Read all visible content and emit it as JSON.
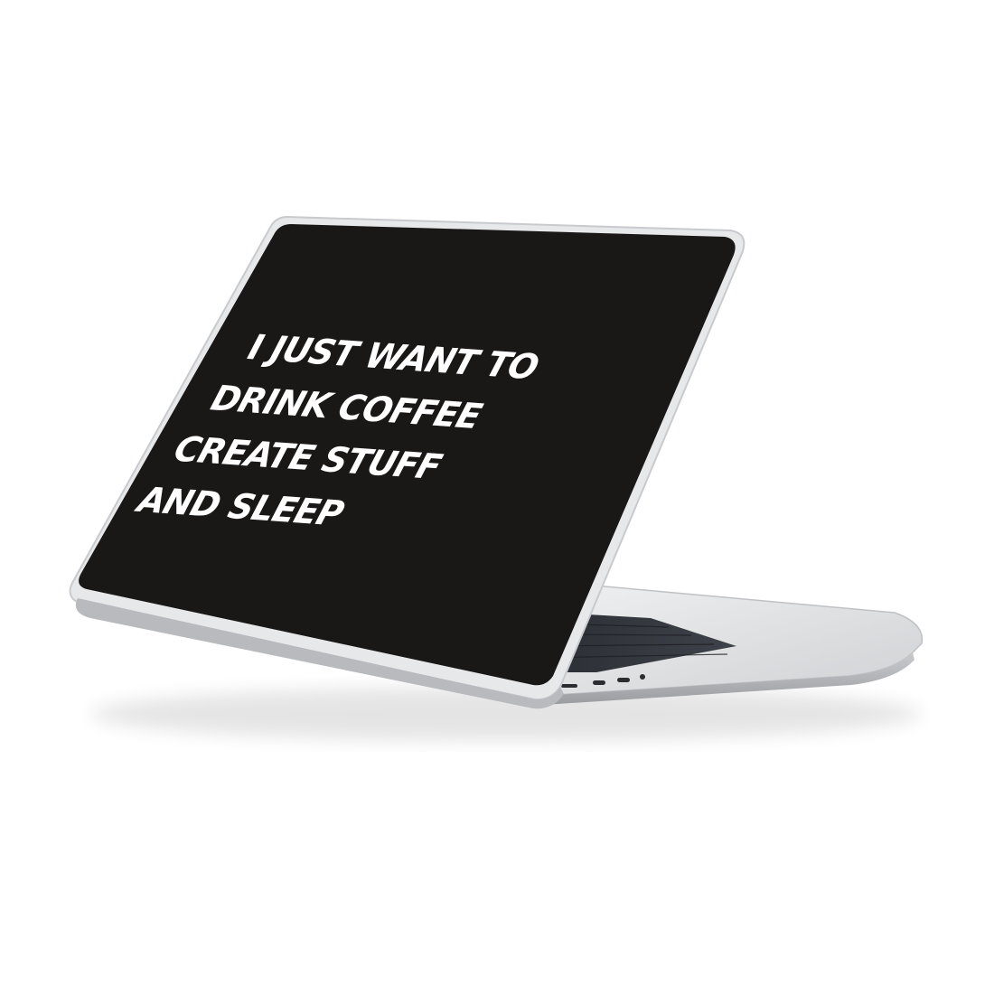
{
  "product": {
    "case_print_lines": [
      "I JUST WANT TO",
      "DRINK COFFEE",
      "CREATE STUFF",
      "AND SLEEP"
    ],
    "case_color": "#1a1717",
    "text_color": "#ffffff",
    "frame_color": "#d9dbdd",
    "body_color": "#e4e5e7"
  }
}
